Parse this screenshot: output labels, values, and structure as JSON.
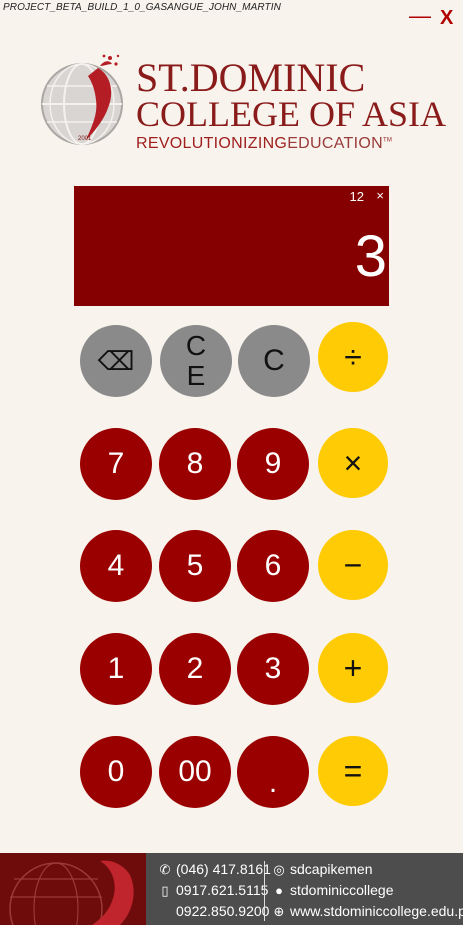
{
  "window": {
    "title": "PROJECT_BETA_BUILD_1_0_GASANGUE_JOHN_MARTIN",
    "minimize_label": "—",
    "close_label": "X"
  },
  "logo": {
    "line1": "ST.DOMINIC",
    "line2": "COLLEGE OF ASIA",
    "tagline_a": "REVOLUTIONIZING",
    "tagline_b": "EDUCATION",
    "tm": "TM",
    "globe_year": "2001"
  },
  "display": {
    "digit_count": "12",
    "close_glyph": "×",
    "value": "3"
  },
  "keys": {
    "backspace": "⌫",
    "ce": "CE",
    "c": "C",
    "divide": "÷",
    "seven": "7",
    "eight": "8",
    "nine": "9",
    "multiply": "×",
    "four": "4",
    "five": "5",
    "six": "6",
    "minus": "−",
    "one": "1",
    "two": "2",
    "three": "3",
    "plus": "+",
    "zero": "0",
    "double_zero": "00",
    "dot": ".",
    "equals": "="
  },
  "footer": {
    "phone1": "(046) 417.8161",
    "mobile1": "0917.621.5115",
    "mobile2": "0922.850.9200",
    "instagram": "sdcapikemen",
    "facebook": "stdominiccollege",
    "website": "www.stdominiccollege.edu.ph"
  },
  "colors": {
    "background": "#f8f3ec",
    "display": "#850000",
    "number_key": "#9a0000",
    "function_key": "#8a8a8a",
    "operator_key": "#ffcb05",
    "brand": "#8a1b1b"
  }
}
